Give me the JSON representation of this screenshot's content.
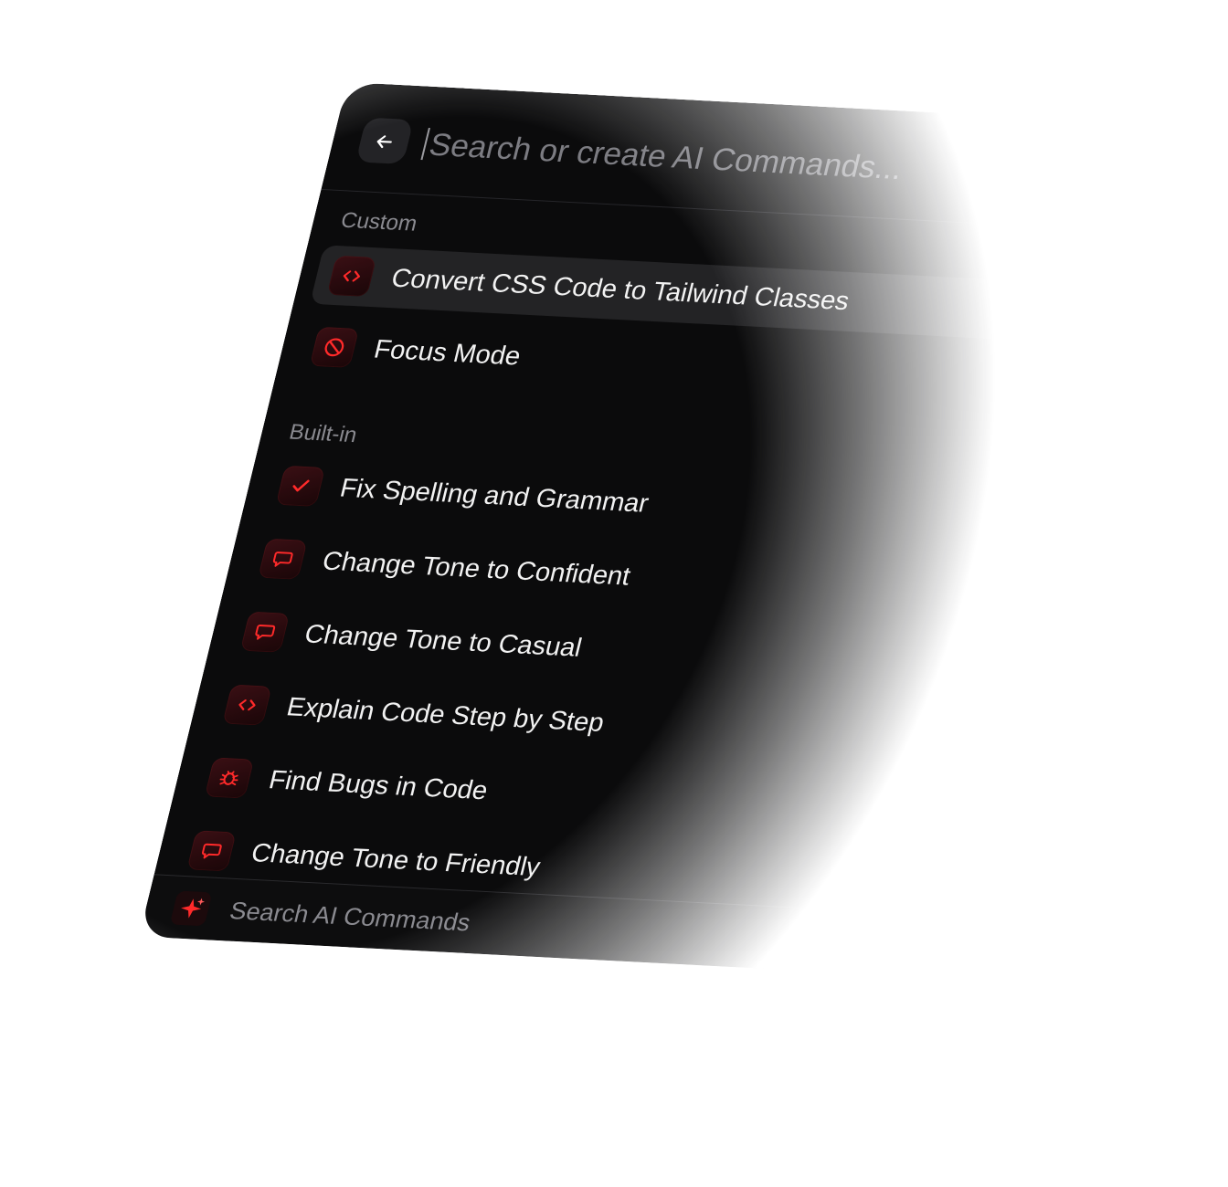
{
  "search": {
    "placeholder": "Search or create AI Commands..."
  },
  "header": {
    "back_icon": "arrow-left-icon"
  },
  "sections": {
    "custom_label": "Custom",
    "builtin_label": "Built-in"
  },
  "custom_items": [
    {
      "label": "Convert CSS Code to Tailwind Classes",
      "icon": "code-icon",
      "active": true
    },
    {
      "label": "Focus Mode",
      "icon": "prohibited-icon",
      "active": false
    }
  ],
  "builtin_items": [
    {
      "label": "Fix Spelling and Grammar",
      "icon": "checkmark-icon"
    },
    {
      "label": "Change Tone to Confident",
      "icon": "speech-bubble-icon"
    },
    {
      "label": "Change Tone to Casual",
      "icon": "speech-bubble-icon"
    },
    {
      "label": "Explain Code Step by Step",
      "icon": "code-icon"
    },
    {
      "label": "Find Bugs in Code",
      "icon": "bug-icon"
    },
    {
      "label": "Change Tone to Friendly",
      "icon": "speech-bubble-icon"
    }
  ],
  "footer": {
    "label": "Search AI Commands",
    "icon": "sparkle-icon"
  },
  "colors": {
    "panel_bg": "#0b0b0c",
    "accent": "#ff2a2a",
    "active_row": "#232325",
    "muted_text": "#8a8a90"
  }
}
